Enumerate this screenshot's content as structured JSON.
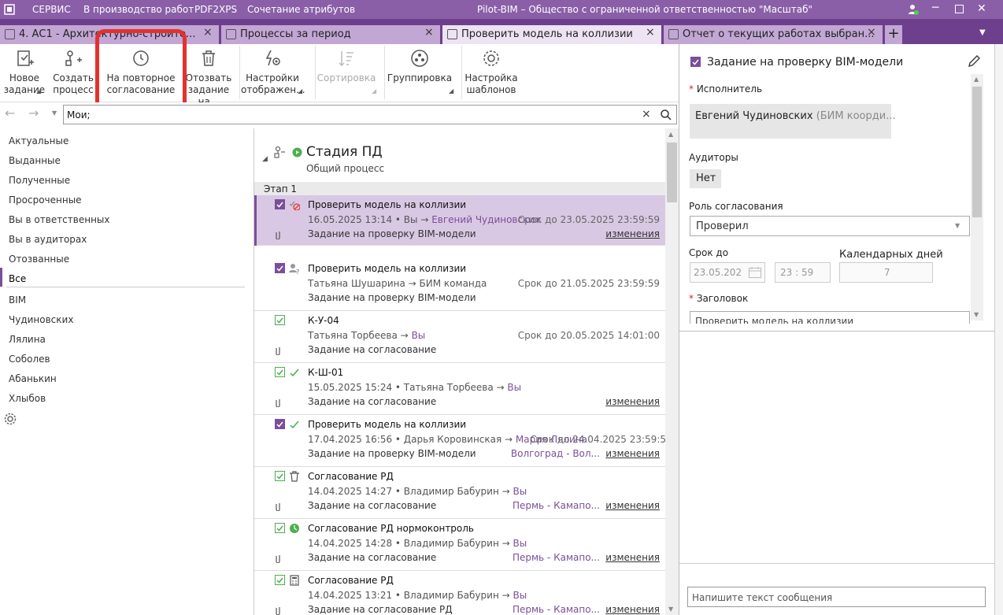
{
  "titlebar": {
    "menu": [
      "СЕРВИС",
      "В производство работ",
      "PDF2XPS",
      "Сочетание атрибутов"
    ],
    "title": "Pilot-BIM – Общество с ограниченной ответственностью \"Масштаб\""
  },
  "tabs": [
    {
      "label": "4. АС1 - Архитектурно-строите..."
    },
    {
      "label": "Процессы за период"
    },
    {
      "label": "Проверить модель на коллизии"
    },
    {
      "label": "Отчет о текущих работах выбран..."
    }
  ],
  "toolbar": {
    "new_task": "Новое задание",
    "create_process": "Создать процесс",
    "reapproval": "На повторное согласование",
    "recall": "Отозвать задание на...",
    "display_settings": "Настройки отображен...",
    "sort": "Сортировка",
    "group": "Группировка",
    "template_settings": "Настройка шаблонов"
  },
  "search": {
    "value": "Мои;"
  },
  "sidebar": {
    "items": [
      "Актуальные",
      "Выданные",
      "Полученные",
      "Просроченные",
      "Вы в ответственных",
      "Вы в аудиторах",
      "Отозванные",
      "Все"
    ],
    "groups": [
      "BIM",
      "Чудиновских",
      "Лялина",
      "Соболев",
      "Абанькин",
      "Хлыбов"
    ]
  },
  "list": {
    "stage": {
      "title": "Стадия ПД",
      "subtitle": "Общий процесс"
    },
    "group_label": "Этап 1",
    "items": [
      {
        "title": "Проверить модель на коллизии",
        "meta": "16.05.2025 13:14 • Вы →",
        "meta_link": "Евгений Чудиновских",
        "due": "Срок до 23.05.2025 23:59:59",
        "desc": "Задание на проверку BIM-модели",
        "changes": "изменения",
        "loc": ""
      },
      {
        "title": "Проверить модель на коллизии",
        "meta": "Татьяна Шушарина → БИМ команда",
        "meta_link": "",
        "due": "Срок до 21.05.2025 23:59:59",
        "desc": "Задание на проверку BIM-модели",
        "changes": "",
        "loc": ""
      },
      {
        "title": "К-У-04",
        "meta": "Татьяна Торбеева →",
        "meta_link": "Вы",
        "due": "Срок до 20.05.2025 14:01:00",
        "desc": "Задание на согласование",
        "changes": "",
        "loc": ""
      },
      {
        "title": "К-Ш-01",
        "meta": "15.05.2025 15:24 • Татьяна Торбеева →",
        "meta_link": "Вы",
        "due": "",
        "desc": "Задание на согласование",
        "changes": "изменения",
        "loc": ""
      },
      {
        "title": "Проверить модель на коллизии",
        "meta": "17.04.2025 16:56 • Дарья Коровинская →",
        "meta_link": "Мария Лялина",
        "due": "Срок до 24.04.2025 23:59:5",
        "desc": "Задание на проверку BIM-модели",
        "changes": "изменения",
        "loc": "Волгоград - Вол..."
      },
      {
        "title": "Согласование РД",
        "meta": "14.04.2025 14:27 • Владимир Бабурин →",
        "meta_link": "Вы",
        "due": "",
        "desc": "Задание на согласование",
        "changes": "изменения",
        "loc": "Пермь - Камапо..."
      },
      {
        "title": "Согласование РД нормоконтроль",
        "meta": "14.04.2025 14:28 • Владимир Бабурин →",
        "meta_link": "Вы",
        "due": "",
        "desc": "Задание на согласование",
        "changes": "изменения",
        "loc": "Пермь - Камапо..."
      },
      {
        "title": "Согласование РД",
        "meta": "14.04.2025 13:21 • Владимир Бабурин →",
        "meta_link": "Вы",
        "due": "",
        "desc": "Задание на согласование РД",
        "changes": "изменения",
        "loc": "Пермь - Камапо..."
      }
    ]
  },
  "detail": {
    "task_title": "Задание на проверку BIM-модели",
    "executor_label": "Исполнитель",
    "executor_name": "Евгений Чудиновских",
    "executor_role": "(БИМ коорди...",
    "auditors_label": "Аудиторы",
    "auditors_value": "Нет",
    "role_label": "Роль согласования",
    "role_value": "Проверил",
    "due_label": "Срок до",
    "due_date": "23.05.202",
    "due_time": "23 : 59",
    "days_label": "Календарных дней",
    "days_value": "7",
    "heading_label": "Заголовок",
    "heading_value": "Проверить модель на коллизии",
    "message_placeholder": "Напишите текст сообщения"
  }
}
